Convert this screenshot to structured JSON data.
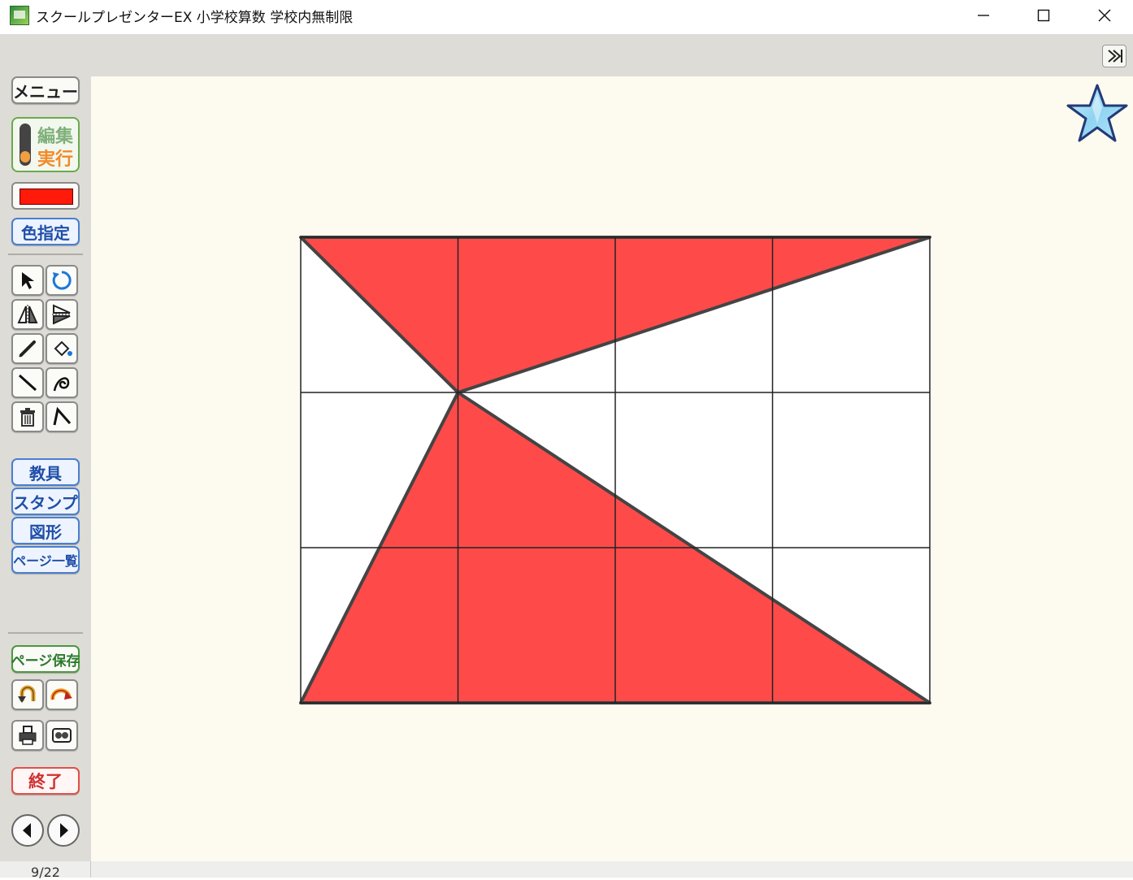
{
  "window": {
    "title": "スクールプレゼンターEX 小学校算数 学校内無制限",
    "minimize_label": "minimize",
    "maximize_label": "maximize",
    "close_label": "close"
  },
  "sidebar": {
    "menu_label": "メニュー",
    "mode_edit_label": "編集",
    "mode_run_label": "実行",
    "current_color": "#ff1a0a",
    "color_select_label": "色指定",
    "tools": [
      {
        "name": "select-arrow-icon"
      },
      {
        "name": "rotate-icon"
      },
      {
        "name": "flip-horizontal-icon"
      },
      {
        "name": "flip-vertical-icon"
      },
      {
        "name": "pen-icon"
      },
      {
        "name": "fill-bucket-icon"
      },
      {
        "name": "line-icon"
      },
      {
        "name": "freehand-curve-icon"
      },
      {
        "name": "trash-icon"
      },
      {
        "name": "polyline-icon"
      }
    ],
    "palette_buttons": [
      "教具",
      "スタンプ",
      "図形",
      "ページ一覧"
    ],
    "save_page_label": "ページ保存",
    "quit_label": "終了"
  },
  "status": {
    "page_indicator": "9/22"
  },
  "canvas": {
    "background": "#fdfaf0",
    "fill_color": "#ff4a4a",
    "outline_color": "#444444",
    "grid": {
      "columns": 4,
      "rows": 3
    }
  },
  "icons": {
    "expand_panel": "double-chevron-right-icon",
    "stamp": "star-icon"
  }
}
